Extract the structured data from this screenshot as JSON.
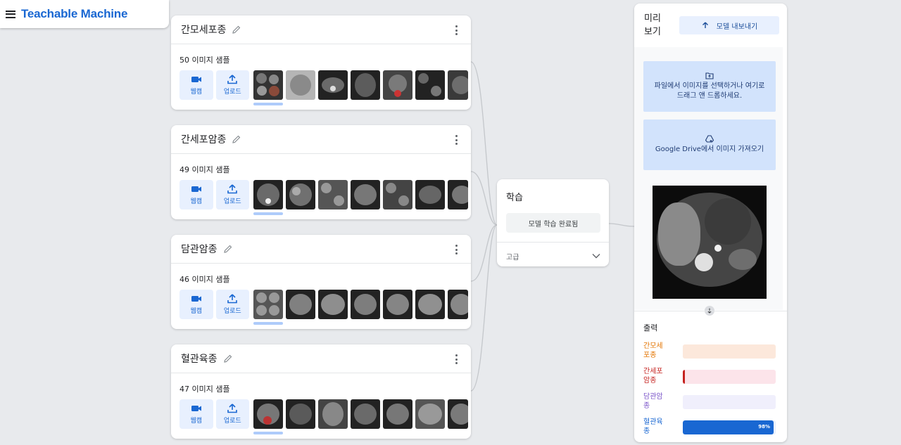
{
  "app": {
    "title": "Teachable Machine",
    "menu_icon": "menu-icon"
  },
  "classes": [
    {
      "name": "간모세포종",
      "samples": "50 이미지 샘플"
    },
    {
      "name": "간세포암종",
      "samples": "49 이미지 샘플"
    },
    {
      "name": "담관암종",
      "samples": "46 이미지 샘플"
    },
    {
      "name": "혈관육종",
      "samples": "47 이미지 샘플"
    }
  ],
  "class_actions": {
    "webcam_label": "웹캠",
    "upload_label": "업로드"
  },
  "training": {
    "title": "학습",
    "button_label": "모델 학습 완료됨",
    "advanced_label": "고급"
  },
  "preview": {
    "title": "미리보기",
    "export_label": "모델 내보내기",
    "file_drop_text": "파일에서 이미지를 선택하거나 여기로 드래그 앤 드롭하세요.",
    "drive_text": "Google Drive에서 이미지 가져오기",
    "output_title": "출력",
    "outputs": [
      {
        "label": "간모세포종",
        "value": 0,
        "color": "#e37400",
        "track": "#fce8db"
      },
      {
        "label": "간세포암종",
        "value": 0.01,
        "color": "#c5221f",
        "track": "#fce4ea"
      },
      {
        "label": "담관암종",
        "value": 0,
        "color": "#7b55c9",
        "track": "#f0effc"
      },
      {
        "label": "혈관육종",
        "value": 0.98,
        "pct_label": "98%",
        "color": "#1967d2",
        "track": "#e8f0fe"
      }
    ]
  },
  "colors": {
    "accent": "#1967d2",
    "panel_blue": "#d2e3fc",
    "button_blue": "#e8f0fe"
  }
}
